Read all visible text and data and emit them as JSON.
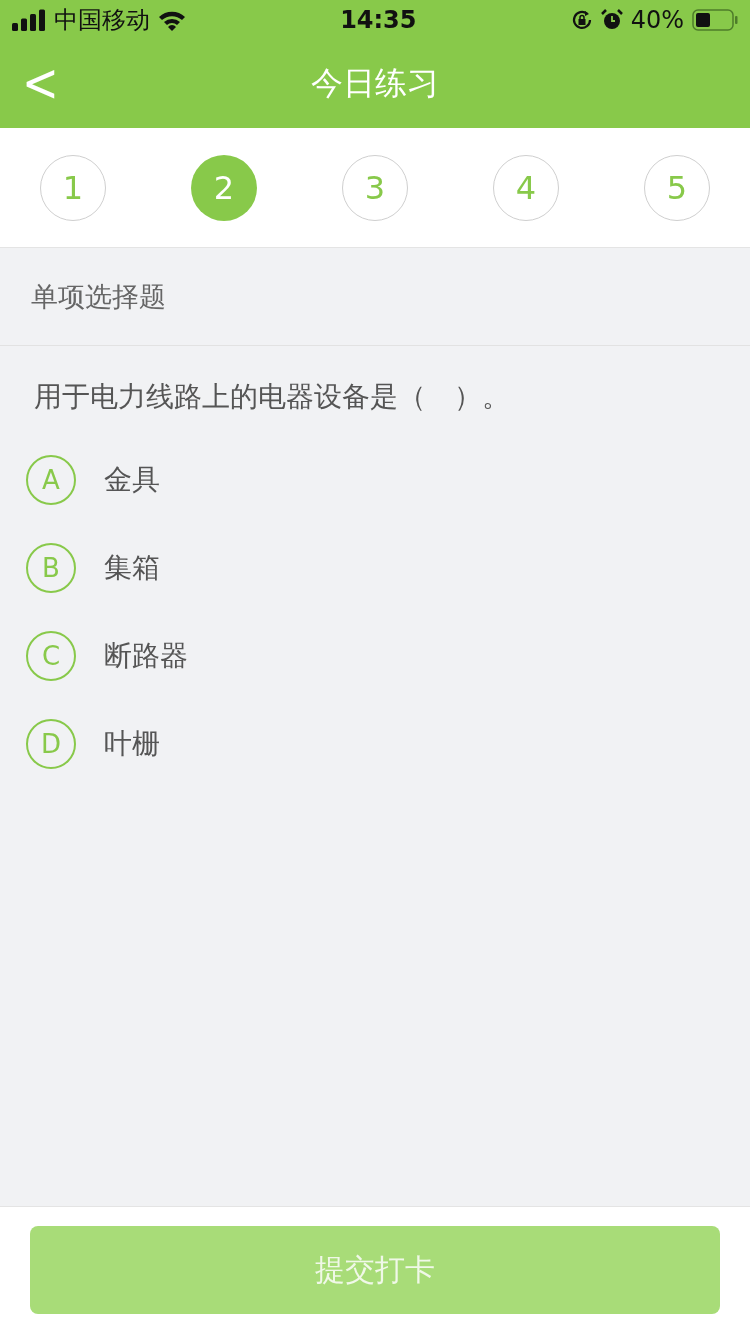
{
  "status_bar": {
    "carrier": "中国移动",
    "time": "14:35",
    "battery": "40%"
  },
  "nav": {
    "back": "<",
    "title": "今日练习"
  },
  "steps": [
    {
      "label": "1",
      "selected": false
    },
    {
      "label": "2",
      "selected": true
    },
    {
      "label": "3",
      "selected": false
    },
    {
      "label": "4",
      "selected": false
    },
    {
      "label": "5",
      "selected": false
    }
  ],
  "section": {
    "title": "单项选择题"
  },
  "question": "用于电力线路上的电器设备是（　）。",
  "options": [
    {
      "letter": "A",
      "text": "金具",
      "selected": false
    },
    {
      "letter": "B",
      "text": "集箱",
      "selected": false
    },
    {
      "letter": "C",
      "text": "断路器",
      "selected": false
    },
    {
      "letter": "D",
      "text": "叶栅",
      "selected": false
    }
  ],
  "submit": {
    "label": "提交打卡",
    "disabled": true
  }
}
